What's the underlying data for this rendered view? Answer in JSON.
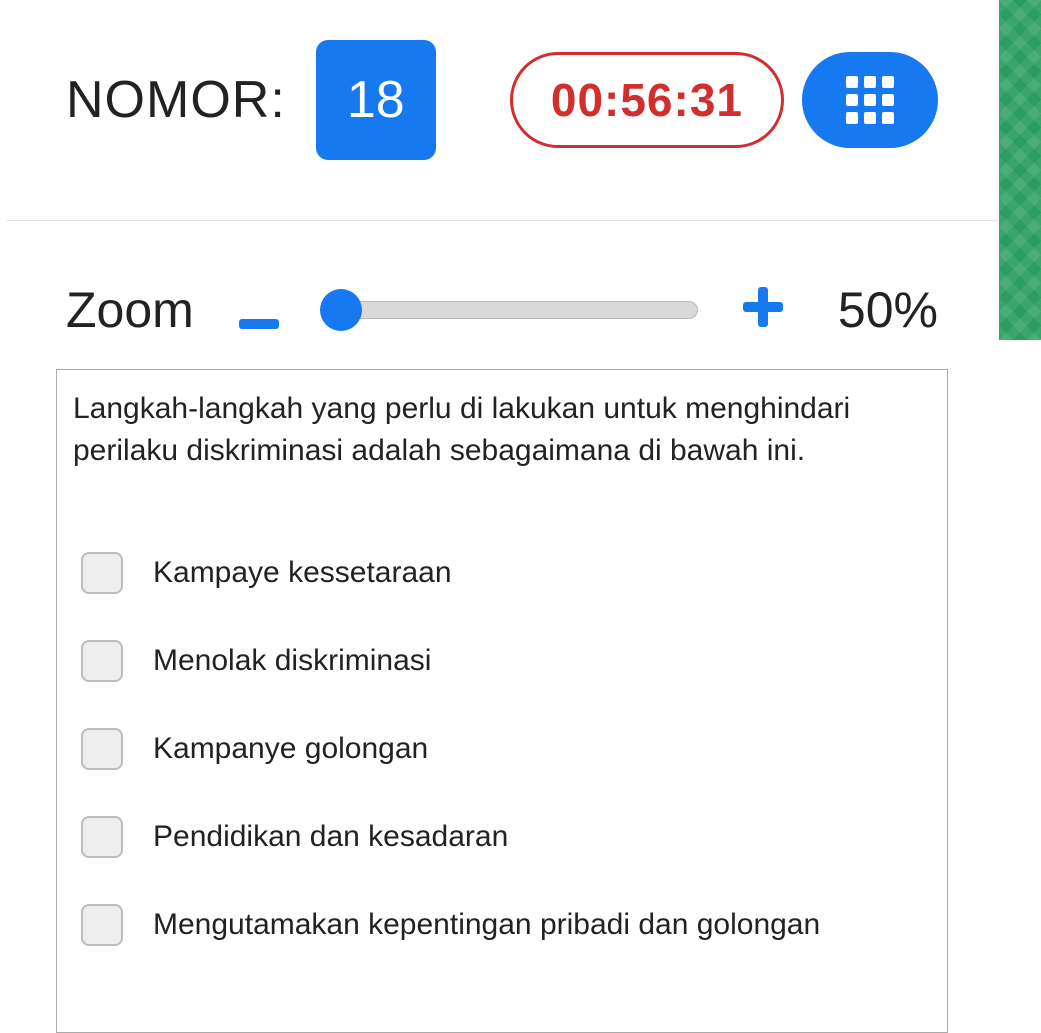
{
  "header": {
    "nomor_label": "NOMOR:",
    "nomor_value": "18",
    "timer": "00:56:31"
  },
  "zoom": {
    "label": "Zoom",
    "value": "50%"
  },
  "question": {
    "text": "Langkah-langkah yang perlu di lakukan untuk menghindari perilaku diskriminasi adalah sebagaimana di bawah ini.",
    "options": [
      "Kampaye kessetaraan",
      "Menolak diskriminasi",
      "Kampanye golongan",
      "Pendidikan dan kesadaran",
      "Mengutamakan kepentingan pribadi dan golongan"
    ]
  }
}
